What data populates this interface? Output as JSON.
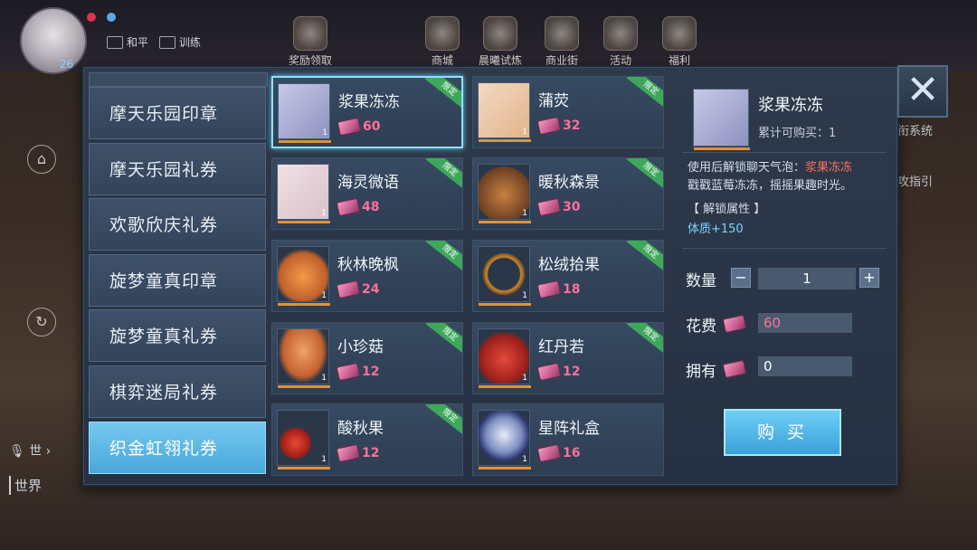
{
  "hud": {
    "level": "26",
    "mode_peace": "和平",
    "mode_train": "训练",
    "nav": [
      "奖励领取",
      "商城",
      "晨曦试炼",
      "商业街",
      "活动",
      "福利"
    ],
    "right_text_1": "衔系统",
    "right_text_2": "攻指引",
    "chat_channel": "世",
    "world_label": "世界"
  },
  "sidebar": {
    "items": [
      {
        "label": "摩天乐园印章",
        "active": false
      },
      {
        "label": "摩天乐园礼券",
        "active": false
      },
      {
        "label": "欢歌欣庆礼券",
        "active": false
      },
      {
        "label": "旋梦童真印章",
        "active": false
      },
      {
        "label": "旋梦童真礼券",
        "active": false
      },
      {
        "label": "棋弈迷局礼券",
        "active": false
      },
      {
        "label": "织金虹翎礼券",
        "active": true
      }
    ]
  },
  "items": [
    {
      "name": "浆果冻冻",
      "price": "60",
      "qty": "1",
      "badge": "限定",
      "selected": true
    },
    {
      "name": "蒲荧",
      "price": "32",
      "qty": "1",
      "badge": "限定",
      "selected": false
    },
    {
      "name": "海灵微语",
      "price": "48",
      "qty": "1",
      "badge": "限定",
      "selected": false
    },
    {
      "name": "暖秋森景",
      "price": "30",
      "qty": "1",
      "badge": "限定",
      "selected": false
    },
    {
      "name": "秋林晚枫",
      "price": "24",
      "qty": "1",
      "badge": "限定",
      "selected": false
    },
    {
      "name": "松绒拾果",
      "price": "18",
      "qty": "1",
      "badge": "限定",
      "selected": false
    },
    {
      "name": "小珍菇",
      "price": "12",
      "qty": "1",
      "badge": "限定",
      "selected": false
    },
    {
      "name": "红丹若",
      "price": "12",
      "qty": "1",
      "badge": "限定",
      "selected": false
    },
    {
      "name": "酸秋果",
      "price": "12",
      "qty": "1",
      "badge": "限定",
      "selected": false
    },
    {
      "name": "星阵礼盒",
      "price": "16",
      "qty": "1",
      "badge": "",
      "selected": false
    }
  ],
  "detail": {
    "name": "浆果冻冻",
    "limit_text": "累计可购买：1",
    "desc_prefix": "使用后解锁聊天气泡：",
    "desc_highlight": "浆果冻冻",
    "desc_body": "戳戳蓝莓冻冻，摇摇果趣时光。",
    "unlock_label": "【 解锁属性 】",
    "attr_text": "体质+150",
    "qty_label": "数量",
    "qty_value": "1",
    "cost_label": "花费",
    "cost_value": "60",
    "own_label": "拥有",
    "own_value": "0",
    "buy_label": "购 买",
    "minus": "−",
    "plus": "+"
  },
  "close_symbol": "✕",
  "colors": {
    "accent_blue": "#4aa8db",
    "price_pink": "#ff6f9d",
    "highlight_red": "#ff6f5a",
    "attr_blue": "#7fd3ff",
    "badge_green": "#3ea85a"
  }
}
